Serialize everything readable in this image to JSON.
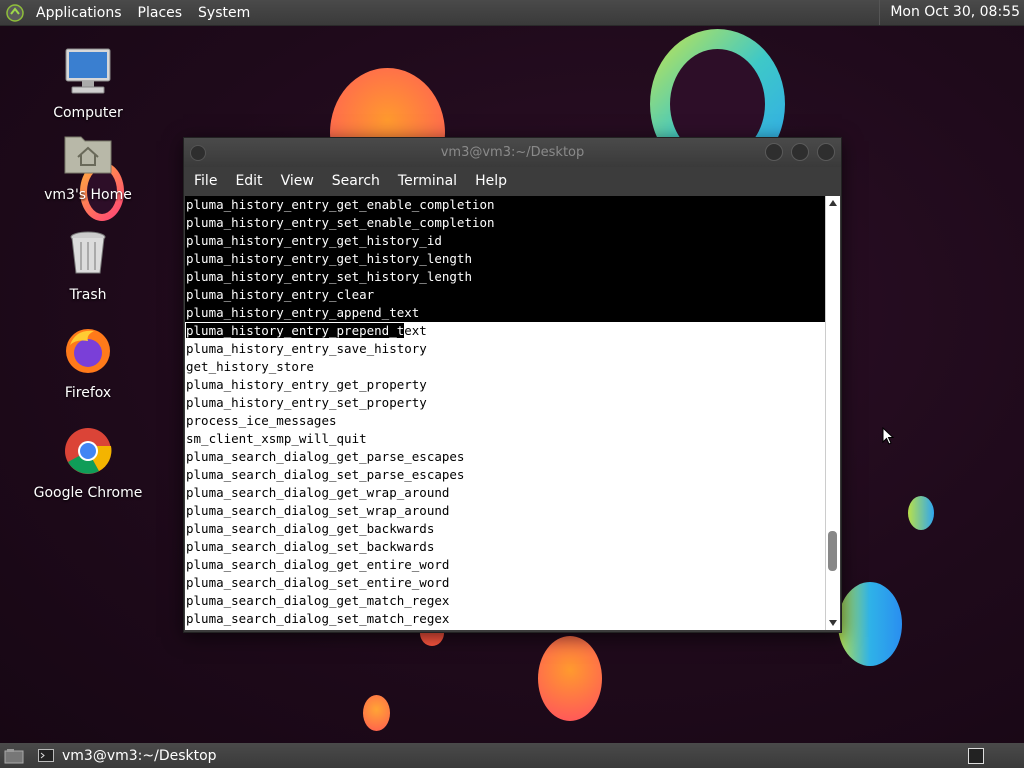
{
  "top_panel": {
    "menu": [
      "Applications",
      "Places",
      "System"
    ],
    "clock": "Mon Oct 30, 08:55"
  },
  "desktop_icons": [
    {
      "label": "Computer",
      "icon": "computer-icon"
    },
    {
      "label": "vm3's Home",
      "icon": "home-folder-icon"
    },
    {
      "label": "Trash",
      "icon": "trash-icon"
    },
    {
      "label": "Firefox",
      "icon": "firefox-icon"
    },
    {
      "label": "Google Chrome",
      "icon": "chrome-icon"
    }
  ],
  "terminal": {
    "title": "vm3@vm3:~/Desktop",
    "menu": [
      "File",
      "Edit",
      "View",
      "Search",
      "Terminal",
      "Help"
    ],
    "lines": [
      {
        "text": "pluma_history_entry_get_enable_completion",
        "selected": "full"
      },
      {
        "text": "pluma_history_entry_set_enable_completion",
        "selected": "full"
      },
      {
        "text": "pluma_history_entry_get_history_id",
        "selected": "full"
      },
      {
        "text": "pluma_history_entry_get_history_length",
        "selected": "full"
      },
      {
        "text": "pluma_history_entry_set_history_length",
        "selected": "full"
      },
      {
        "text": "pluma_history_entry_clear",
        "selected": "full"
      },
      {
        "text": "pluma_history_entry_append_text",
        "selected": "full"
      },
      {
        "text": "pluma_history_entry_prepend_text",
        "selected": "partial",
        "selected_chars": 29
      },
      {
        "text": "pluma_history_entry_save_history",
        "selected": "none"
      },
      {
        "text": "get_history_store",
        "selected": "none"
      },
      {
        "text": "pluma_history_entry_get_property",
        "selected": "none"
      },
      {
        "text": "pluma_history_entry_set_property",
        "selected": "none"
      },
      {
        "text": "process_ice_messages",
        "selected": "none"
      },
      {
        "text": "sm_client_xsmp_will_quit",
        "selected": "none"
      },
      {
        "text": "pluma_search_dialog_get_parse_escapes",
        "selected": "none"
      },
      {
        "text": "pluma_search_dialog_set_parse_escapes",
        "selected": "none"
      },
      {
        "text": "pluma_search_dialog_get_wrap_around",
        "selected": "none"
      },
      {
        "text": "pluma_search_dialog_set_wrap_around",
        "selected": "none"
      },
      {
        "text": "pluma_search_dialog_get_backwards",
        "selected": "none"
      },
      {
        "text": "pluma_search_dialog_set_backwards",
        "selected": "none"
      },
      {
        "text": "pluma_search_dialog_get_entire_word",
        "selected": "none"
      },
      {
        "text": "pluma_search_dialog_set_entire_word",
        "selected": "none"
      },
      {
        "text": "pluma_search_dialog_get_match_regex",
        "selected": "none"
      },
      {
        "text": "pluma_search_dialog_set_match_regex",
        "selected": "none"
      }
    ]
  },
  "bottom_panel": {
    "task_label": "vm3@vm3:~/Desktop"
  },
  "colors": {
    "panel": "#3f3f3f",
    "terminal_bg": "#ffffff",
    "selection_bg": "#000000"
  }
}
